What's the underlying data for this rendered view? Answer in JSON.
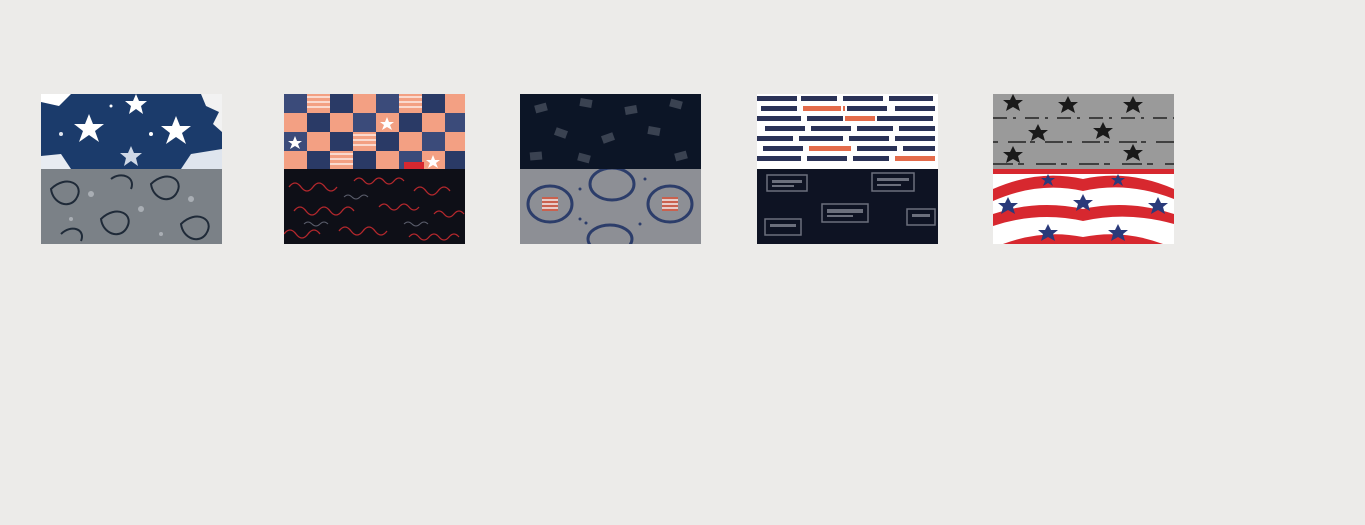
{
  "swatches": [
    {
      "pattern": "navy-distressed-stars",
      "colors": {
        "base": "#1b3b6b",
        "accent": "#ffffff"
      }
    },
    {
      "pattern": "gray-paisley",
      "colors": {
        "base": "#7b8187",
        "accent": "#1f2a38"
      }
    },
    {
      "pattern": "patriotic-patchwork",
      "colors": {
        "base": "#2a3a66",
        "accent": "#f3a083"
      }
    },
    {
      "pattern": "black-script-red",
      "colors": {
        "base": "#0e0f17",
        "accent": "#b5282d"
      }
    },
    {
      "pattern": "dark-navy-flags",
      "colors": {
        "base": "#0c1526",
        "accent": "#4a5160"
      }
    },
    {
      "pattern": "gray-badges",
      "colors": {
        "base": "#8d8f95",
        "accent": "#2c3d6a"
      }
    },
    {
      "pattern": "jockey-wordmark",
      "colors": {
        "base": "#ffffff",
        "accent": "#e36b4b"
      }
    },
    {
      "pattern": "dark-label-print",
      "colors": {
        "base": "#0e1323",
        "accent": "#6b6f7c"
      }
    },
    {
      "pattern": "gray-black-stars",
      "colors": {
        "base": "#9a9a9a",
        "accent": "#1a1a1a"
      }
    },
    {
      "pattern": "red-white-blue-stars",
      "colors": {
        "base": "#ffffff",
        "accent": "#d7282f"
      }
    }
  ]
}
